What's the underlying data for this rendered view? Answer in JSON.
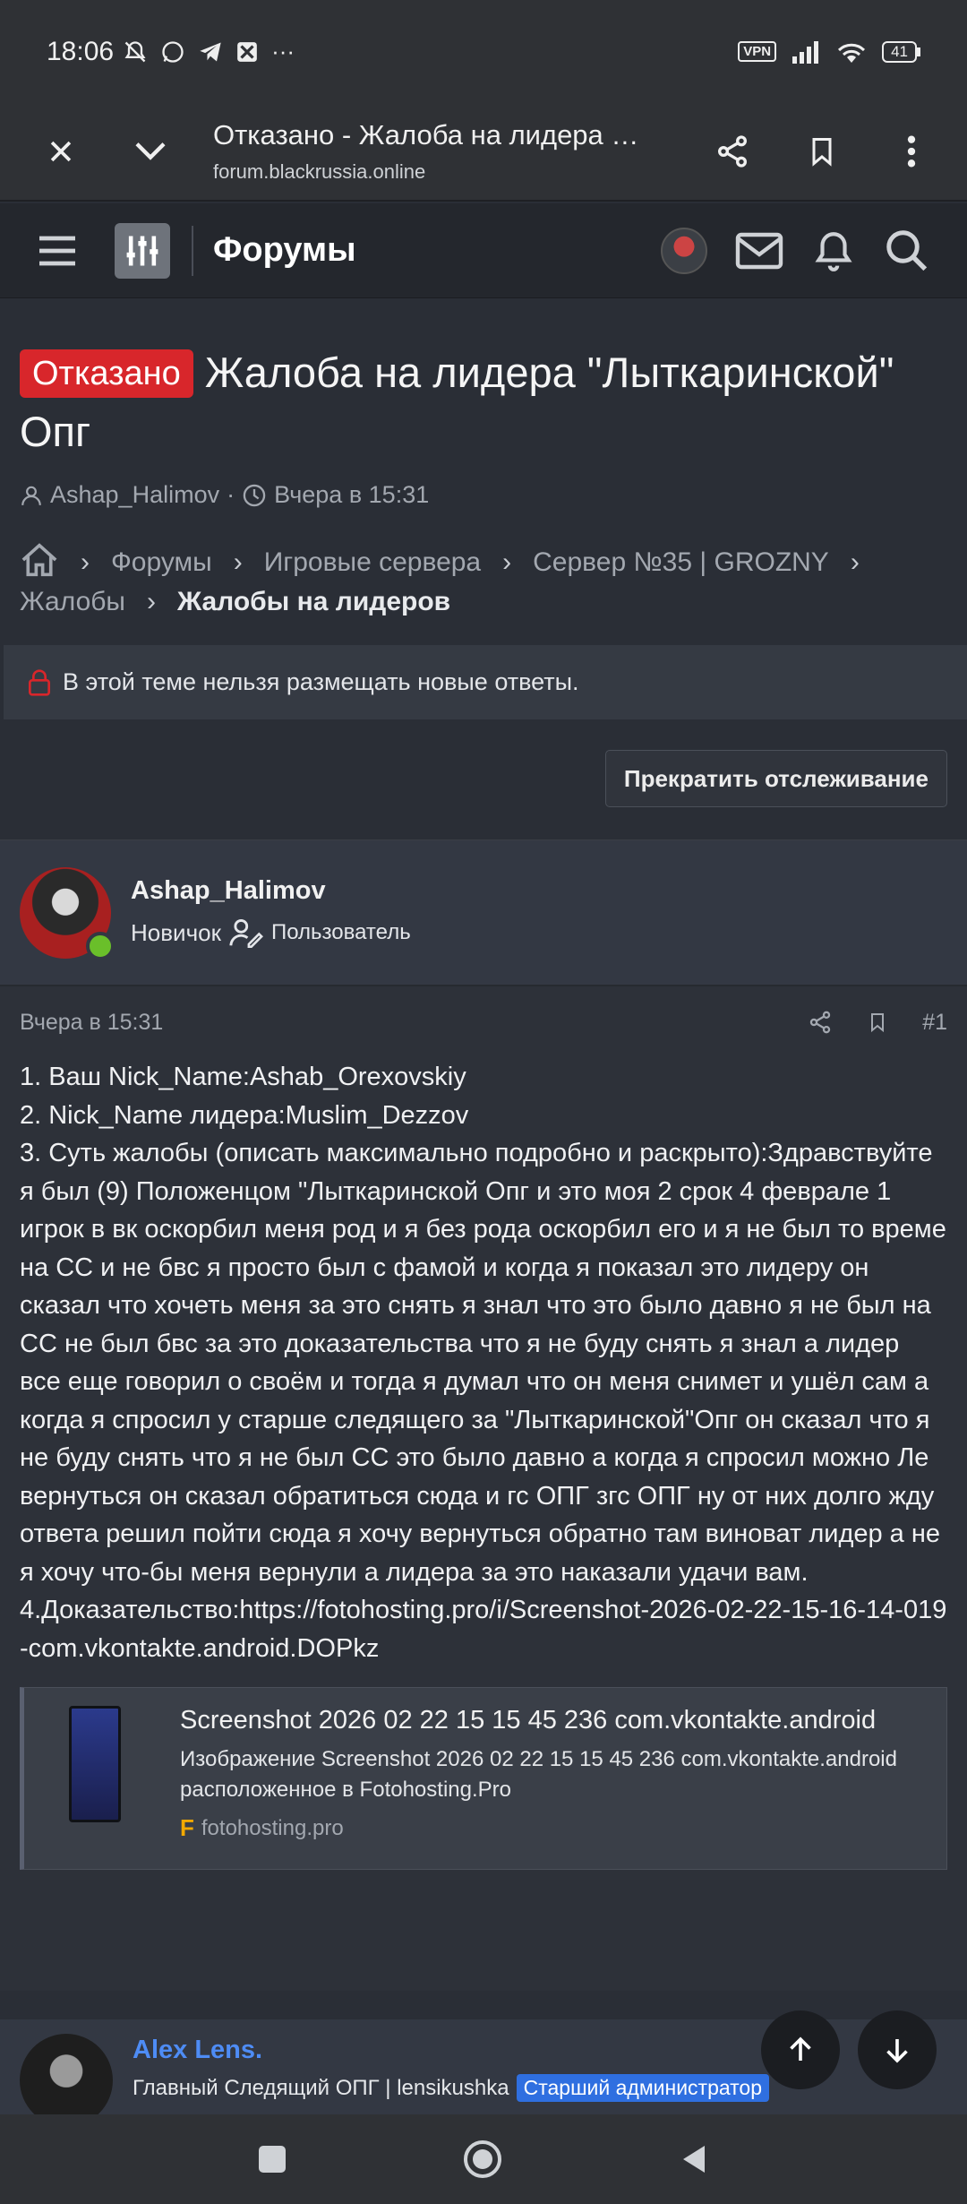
{
  "statusbar": {
    "time": "18:06",
    "more": "···",
    "vpn": "VPN",
    "battery": "41"
  },
  "browser": {
    "title": "Отказано - Жалоба на лидера \"Лыткаринской\" Опг",
    "url": "forum.blackrussia.online"
  },
  "forum": {
    "title": "Форумы"
  },
  "thread": {
    "status": "Отказано",
    "title": "Жалоба на лидера \"Лыткаринской\" Опг",
    "author": "Ashap_Halimov",
    "date": "Вчера в 15:31"
  },
  "breadcrumbs": {
    "items": [
      "Форумы",
      "Игровые сервера",
      "Сервер №35 | GROZNY",
      "Жалобы"
    ],
    "current": "Жалобы на лидеров"
  },
  "notice": {
    "locked": "В этой теме нельзя размещать новые ответы."
  },
  "actions": {
    "unwatch": "Прекратить отслеживание"
  },
  "post": {
    "username": "Ashap_Halimov",
    "rank": "Новичок",
    "group": "Пользователь",
    "date": "Вчера в 15:31",
    "number": "#1",
    "lines": [
      "1. Ваш Nick_Name:Ashab_Orexovskiy",
      "2. Nick_Name лидера:Muslim_Dezzov",
      "3. Суть жалобы (описать максимально подробно и раскрыто):Здравствуйте я был (9) Положенцом \"Лыткаринской Опг и это моя 2 срок 4 феврале 1 игрок в вк оскорбил меня род и я без рода оскорбил его и я не был то време на СС и не бвс я просто был с фамой и когда я показал это лидеру он сказал что хочеть меня за это снять я знал что это было давно я не был на СС не был бвс за это доказательства что я не буду снять я знал а лидер все еще говорил о своём и тогда я думал что он меня снимет и ушёл сам а когда я спросил у старше следящего за \"Лыткаринской\"Опг он сказал что я не буду снять что я не был СС это было давно а когда я спросил можно Ле вернуться он сказал обратиться сюда и гс ОПГ згс ОПГ ну от них долго жду ответа решил пойти сюда я хочу вернуться обратно там виноват лидер а не я хочу что-бы меня вернули а лидера за это наказали удачи вам.",
      "4.Доказательство:https://fotohosting.pro/i/Screenshot-2026-02-22-15-16-14-019-com.vkontakte.android.DOPkz"
    ],
    "embed": {
      "title": "Screenshot 2026 02 22 15 15 45 236 com.vkontakte.android",
      "description": "Изображение Screenshot 2026 02 22 15 15 45 236 com.vkontakte.android расположенное в Fotohosting.Pro",
      "source": "fotohosting.pro"
    }
  },
  "next_post": {
    "username": "Alex Lens.",
    "title": "Главный Следящий ОПГ | lensikushka",
    "badge": "Старший администратор"
  },
  "colors": {
    "accent_red": "#d8262b",
    "link_blue": "#4e8cf5",
    "badge_blue": "#2f6fe0",
    "online_green": "#6abf2a"
  }
}
